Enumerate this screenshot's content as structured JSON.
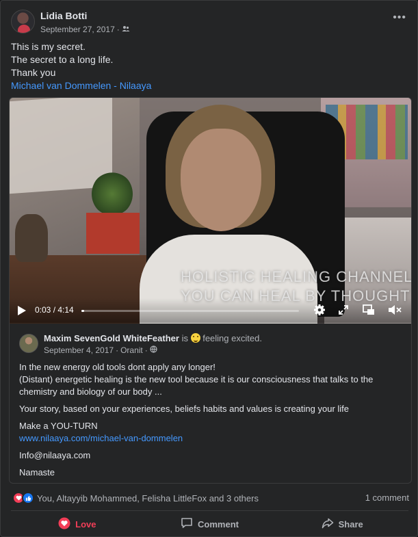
{
  "post": {
    "author": "Lidia Botti",
    "date": "September 27, 2017",
    "separator": "·",
    "audience_icon": "friends-icon",
    "lines": [
      "This is my secret.",
      "The secret to a long life.",
      "Thank you"
    ],
    "link_text": "Michael van Dommelen - Nilaaya"
  },
  "video": {
    "overlay_line1": "HOLISTIC HEALING CHANNEL",
    "overlay_line2": "YOU CAN HEAL BY THOUGHT",
    "current_time": "0:03",
    "duration": "4:14",
    "time_separator": " / ",
    "progress_fraction": 0.012,
    "icons": [
      "play-icon",
      "settings-gear-icon",
      "fullscreen-icon",
      "picture-in-picture-icon",
      "mute-icon"
    ]
  },
  "shared": {
    "author": "Maxim SevenGold WhiteFeather",
    "is": "is",
    "feeling": "feeling excited.",
    "date": "September 4, 2017",
    "location": "Oranit",
    "separator": "·",
    "privacy_icon": "globe-icon",
    "paragraph1_line1": "In the new energy old tools dont apply any longer!",
    "paragraph1_line2": "(Distant) energetic healing is the new tool because it is our consciousness that talks to the chemistry and biology of our body ...",
    "paragraph2": "Your story, based on your experiences, beliefs habits and values is creating your life",
    "paragraph3": "Make a YOU-TURN",
    "link": "www.nilaaya.com/michael-van-dommelen",
    "email": "Info@nilaaya.com",
    "signoff": "Namaste"
  },
  "reactions": {
    "names": "You, Altayyib Mohammed, Felisha LittleFox and 3 others",
    "comments": "1 comment"
  },
  "actions": {
    "love": "Love",
    "comment": "Comment",
    "share": "Share"
  },
  "colors": {
    "background": "#242526",
    "link": "#4599ff",
    "love": "#f33e58",
    "like": "#1877f2",
    "muted_text": "#b0b3b8"
  }
}
